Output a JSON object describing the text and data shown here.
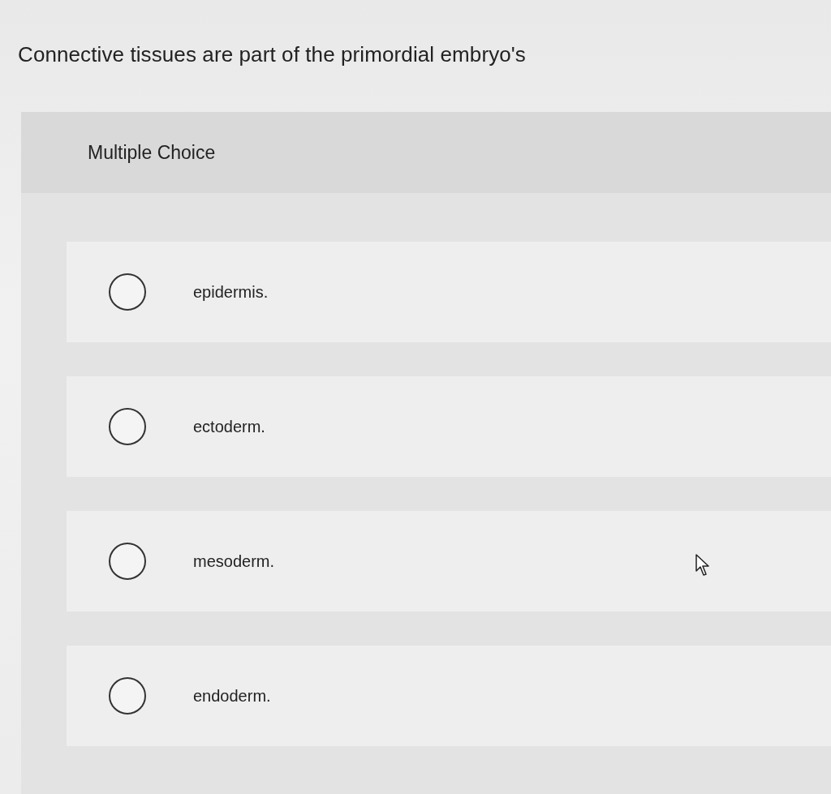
{
  "question": {
    "text": "Connective tissues are part of the primordial embryo's"
  },
  "panel": {
    "heading": "Multiple Choice",
    "options": [
      {
        "label": "epidermis.",
        "selected": false
      },
      {
        "label": "ectoderm.",
        "selected": false
      },
      {
        "label": "mesoderm.",
        "selected": false
      },
      {
        "label": "endoderm.",
        "selected": false
      }
    ]
  }
}
